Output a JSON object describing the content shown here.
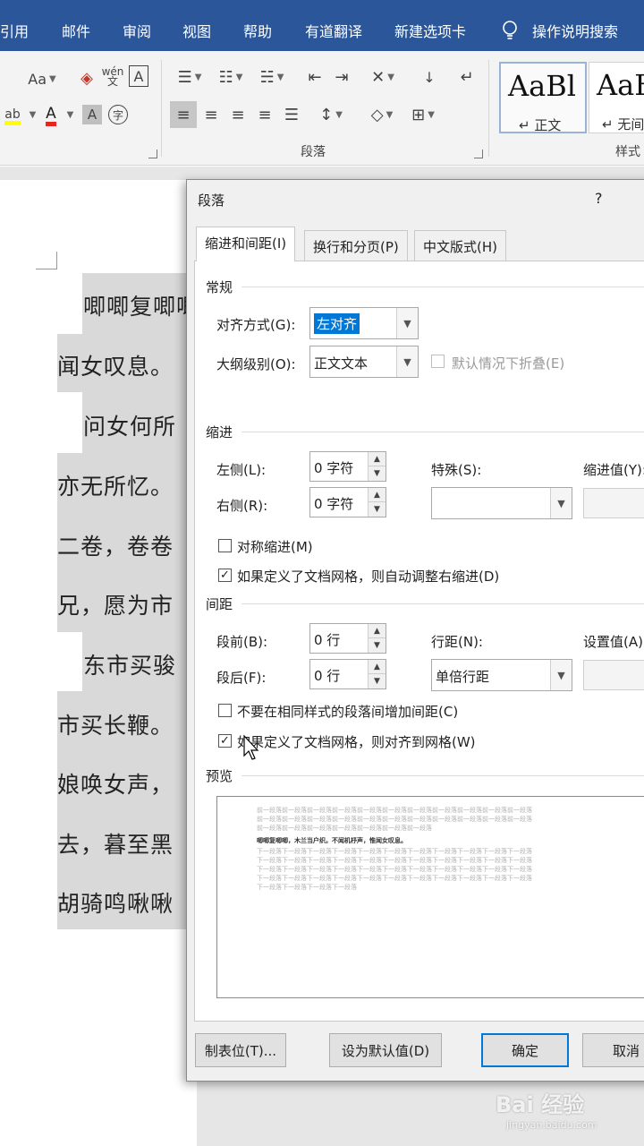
{
  "ribbon_tabs": [
    "引用",
    "邮件",
    "审阅",
    "视图",
    "帮助",
    "有道翻译",
    "新建选项卡",
    "操作说明搜索"
  ],
  "ribbon": {
    "paragraph_group_label": "段落",
    "styles_group_label": "样式",
    "style_cards": [
      {
        "sample": "AaBl",
        "name": "正文",
        "selected": true
      },
      {
        "sample": "AaB",
        "name": "无间隔",
        "selected": false
      }
    ],
    "font_buttons": {
      "case": "Aa",
      "phonetic": "wén\n文",
      "border_char": "A",
      "font_color": "A",
      "shading": "A",
      "enclose": "字"
    }
  },
  "document": {
    "lines": [
      "唧唧复唧唧",
      "闻女叹息。",
      "问女何所",
      "亦无所忆。",
      "二卷，卷卷",
      "兄，愿为市",
      "东市买骏",
      "市买长鞭。",
      "娘唤女声，",
      "去，暮至黑",
      "胡骑鸣啾啾"
    ]
  },
  "dialog": {
    "title": "段落",
    "help": "?",
    "tabs": [
      "缩进和间距(I)",
      "换行和分页(P)",
      "中文版式(H)"
    ],
    "active_tab": 0,
    "general": {
      "section": "常规",
      "alignment_label": "对齐方式(G):",
      "alignment_value": "左对齐",
      "outline_label": "大纲级别(O):",
      "outline_value": "正文文本",
      "collapse_label": "默认情况下折叠(E)",
      "collapse_checked": false
    },
    "indent": {
      "section": "缩进",
      "left_label": "左侧(L):",
      "left_value": "0 字符",
      "right_label": "右侧(R):",
      "right_value": "0 字符",
      "special_label": "特殊(S):",
      "special_value": "",
      "by_label": "缩进值(Y):",
      "by_value": "",
      "mirror_label": "对称缩进(M)",
      "mirror_checked": false,
      "auto_adjust_label": "如果定义了文档网格，则自动调整右缩进(D)",
      "auto_adjust_checked": true
    },
    "spacing": {
      "section": "间距",
      "before_label": "段前(B):",
      "before_value": "0 行",
      "after_label": "段后(F):",
      "after_value": "0 行",
      "line_spacing_label": "行距(N):",
      "line_spacing_value": "单倍行距",
      "at_label": "设置值(A):",
      "at_value": "",
      "no_space_label": "不要在相同样式的段落间增加间距(C)",
      "no_space_checked": false,
      "snap_grid_label": "如果定义了文档网格，则对齐到网格(W)",
      "snap_grid_checked": true
    },
    "preview": {
      "section": "预览",
      "prev_lines": [
        "前一段落前一段落前一段落前一段落前一段落前一段落前一段落前一段落前一段落前一段落前一段落",
        "前一段落前一段落前一段落前一段落前一段落前一段落前一段落前一段落前一段落前一段落前一段落",
        "前一段落前一段落前一段落前一段落前一段落前一段落前一段落"
      ],
      "sample_line": "唧唧复唧唧，木兰当户织。不闻机杼声，惟闻女叹息。",
      "next_lines": [
        "下一段落下一段落下一段落下一段落下一段落下一段落下一段落下一段落下一段落下一段落下一段落",
        "下一段落下一段落下一段落下一段落下一段落下一段落下一段落下一段落下一段落下一段落下一段落",
        "下一段落下一段落下一段落下一段落下一段落下一段落下一段落下一段落下一段落下一段落下一段落",
        "下一段落下一段落下一段落下一段落下一段落下一段落下一段落下一段落下一段落下一段落下一段落",
        "下一段落下一段落下一段落下一段落"
      ]
    },
    "buttons": {
      "tabs": "制表位(T)...",
      "set_default": "设为默认值(D)",
      "ok": "确定",
      "cancel": "取消"
    }
  },
  "watermark": {
    "brand": "Bai 经验",
    "url": "jingyan.baidu.com"
  },
  "colors": {
    "ribbon_blue": "#2b579a",
    "selection_blue": "#0078d7",
    "highlight_gray": "#d9d9d9"
  }
}
